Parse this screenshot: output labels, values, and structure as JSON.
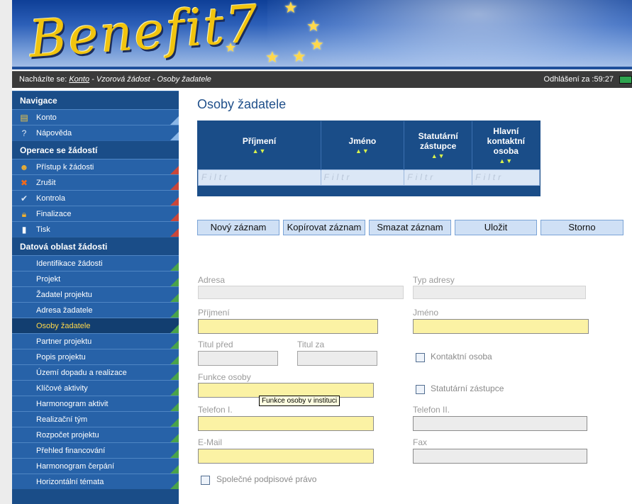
{
  "header": {
    "logo_text": "Benefit7"
  },
  "breadcrumb": {
    "prefix": "Nacházíte se:",
    "link": "Konto",
    "rest": "- Vzorová žádost - Osoby žadatele",
    "timer": "Odhlášení za :59:27"
  },
  "sidebar": {
    "nav_title": "Navigace",
    "nav_items": [
      {
        "label": "Konto",
        "icon": "account-icon"
      },
      {
        "label": "Nápověda",
        "icon": "help-icon"
      }
    ],
    "ops_title": "Operace se žádostí",
    "ops_items": [
      {
        "label": "Přístup k žádosti",
        "icon": "users-icon"
      },
      {
        "label": "Zrušit",
        "icon": "cancel-icon"
      },
      {
        "label": "Kontrola",
        "icon": "check-icon"
      },
      {
        "label": "Finalizace",
        "icon": "lock-icon"
      },
      {
        "label": "Tisk",
        "icon": "print-icon"
      }
    ],
    "data_title": "Datová oblast žádosti",
    "data_items": [
      {
        "label": "Identifikace žádosti"
      },
      {
        "label": "Projekt"
      },
      {
        "label": "Žadatel projektu"
      },
      {
        "label": "Adresa žadatele"
      },
      {
        "label": "Osoby žadatele",
        "active": true
      },
      {
        "label": "Partner projektu"
      },
      {
        "label": "Popis projektu"
      },
      {
        "label": "Území dopadu a realizace"
      },
      {
        "label": "Klíčové aktivity"
      },
      {
        "label": "Harmonogram aktivit"
      },
      {
        "label": "Realizační tým"
      },
      {
        "label": "Rozpočet projektu"
      },
      {
        "label": "Přehled financování"
      },
      {
        "label": "Harmonogram čerpání"
      },
      {
        "label": "Horizontální témata"
      }
    ]
  },
  "main": {
    "title": "Osoby žadatele",
    "grid": {
      "columns": [
        "Příjmení",
        "Jméno",
        "Statutární zástupce",
        "Hlavní kontaktní osoba"
      ],
      "sort_arrows": "▲▼",
      "filter_placeholder": "Filtr"
    },
    "buttons": {
      "new": "Nový záznam",
      "copy": "Kopírovat záznam",
      "delete": "Smazat záznam",
      "save": "Uložit",
      "cancel": "Storno"
    },
    "form": {
      "adresa": "Adresa",
      "typ_adresy": "Typ adresy",
      "prijmeni": "Příjmení",
      "jmeno": "Jméno",
      "titul_pred": "Titul před",
      "titul_za": "Titul za",
      "kontaktni_osoba": "Kontaktní osoba",
      "funkce_osoby": "Funkce osoby",
      "statutarni_zastupce": "Statutární zástupce",
      "telefon1": "Telefon I.",
      "telefon2": "Telefon II.",
      "email": "E-Mail",
      "fax": "Fax",
      "spolecne_pravo": "Společné podpisové právo"
    },
    "tooltip": "Funkce osoby v instituci"
  },
  "colors": {
    "sidebar_bg": "#1a4d88",
    "sidebar_item": "#2762a8",
    "active_text": "#ffd84a",
    "required_field": "#fbf2a4",
    "title": "#1f4f8a"
  }
}
